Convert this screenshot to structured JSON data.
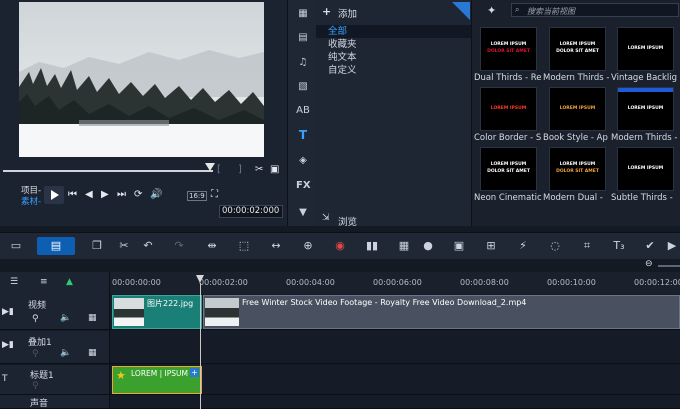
{
  "preview": {
    "label_project": "项目-",
    "label_clip": "素材-",
    "ratio": "16:9",
    "timecode": "00:00:02:000",
    "playhead_fraction": 0.96
  },
  "category": {
    "add_label": "添加",
    "items": [
      "全部",
      "收藏夹",
      "纯文本",
      "自定义"
    ],
    "browse_label": "浏览"
  },
  "library": {
    "search_placeholder": "搜索当前视图",
    "items": [
      {
        "label": "Dual Thirds - Re",
        "line1": "LOREM IPSUM",
        "line2": "DOLOR SIT AMET",
        "color1": "#ffffff",
        "color2": "#e1132e"
      },
      {
        "label": "Modern Thirds -",
        "line1": "LOREM IPSUM",
        "line2": "DOLOR SIT AMET",
        "color1": "#ffffff",
        "color2": "#ffffff"
      },
      {
        "label": "Vintage Backlig",
        "line1": "LOREM IPSUM",
        "line2": "",
        "color1": "#ffffff",
        "color2": "#ffffff"
      },
      {
        "label": "Color Border - S",
        "line1": "LOREM IPSUM",
        "line2": "",
        "color1": "#ff3a2a",
        "color2": "#ffffff"
      },
      {
        "label": "Book Style - Ap",
        "line1": "LOREM IPSUM",
        "line2": "",
        "color1": "#f2a33c",
        "color2": "#ffffff"
      },
      {
        "label": "Modern Thirds -",
        "line1": "LOREM IPSUM",
        "line2": "",
        "color1": "#ffffff",
        "color2": "#1e5bd8"
      },
      {
        "label": "Neon Cinematic",
        "line1": "LOREM IPSUM",
        "line2": "DOLOR SIT AMET",
        "color1": "#ffffff",
        "color2": "#ffffff"
      },
      {
        "label": "Modern Dual -",
        "line1": "LOREM IPSUM",
        "line2": "DOLOR SIT AMET",
        "color1": "#ffffff",
        "color2": "#f2a33c"
      },
      {
        "label": "Subtle Thirds -",
        "line1": "LOREM IPSUM",
        "line2": "",
        "color1": "#ffffff",
        "color2": "#ffffff"
      }
    ]
  },
  "timeline": {
    "ticks": [
      "00:00:00:00",
      "00:00:02:00",
      "00:00:04:00",
      "00:00:06:00",
      "00:00:08:00",
      "00:00:10:00",
      "00:00:12:00"
    ],
    "tracks": [
      {
        "name": "视频"
      },
      {
        "name": "叠加1"
      },
      {
        "name": "标题1"
      },
      {
        "name": "声音"
      }
    ],
    "clip_image": "图片222.jpg",
    "clip_video": "Free Winter Stock Video Footage - Royalty Free Video Download_2.mp4",
    "clip_title": "LOREM | IPSUM"
  },
  "colors": {
    "accent": "#3aa0ff",
    "video_clip": "#1a7f76",
    "title_clip": "#3aa12f",
    "playhead": "#c8c8c8"
  }
}
